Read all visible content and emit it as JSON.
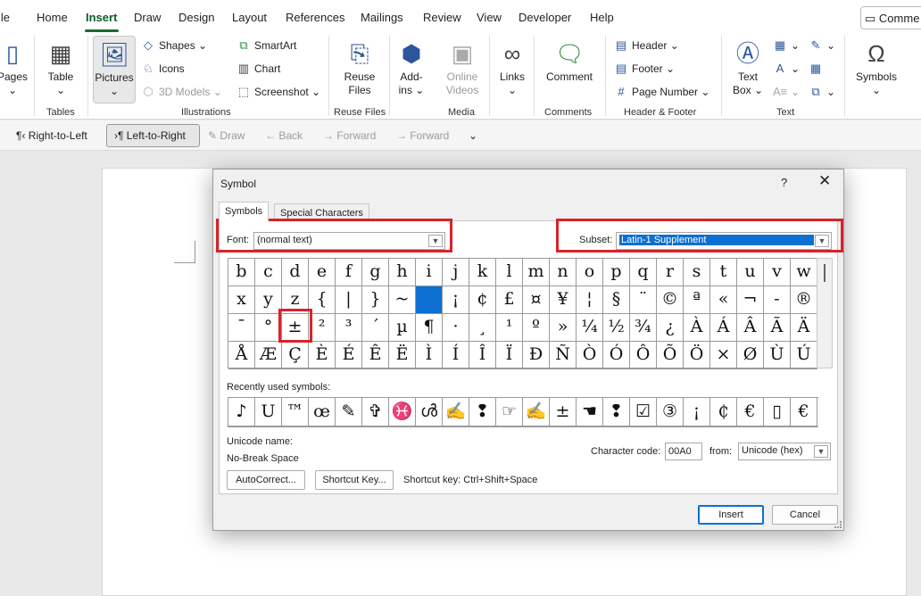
{
  "menubar": {
    "tabs": [
      "ile",
      "Home",
      "Insert",
      "Draw",
      "Design",
      "Layout",
      "References",
      "Mailings",
      "Review",
      "View",
      "Developer",
      "Help"
    ],
    "active_tab": "Insert",
    "comments_label": "Comme"
  },
  "ribbon": {
    "pages_label": "Pages",
    "table_label": "Table",
    "tables_group": "Tables",
    "pictures_label": "Pictures",
    "shapes_label": "Shapes",
    "icons_label": "Icons",
    "models3d_label": "3D Models",
    "smartart_label": "SmartArt",
    "chart_label": "Chart",
    "screenshot_label": "Screenshot",
    "illustrations_group": "Illustrations",
    "reuse_label_1": "Reuse",
    "reuse_label_2": "Files",
    "reuse_group": "Reuse Files",
    "addins_label_1": "Add-",
    "addins_label_2": "ins",
    "online_label_1": "Online",
    "online_label_2": "Videos",
    "media_group": "Media",
    "links_label": "Links",
    "comment_label": "Comment",
    "comments_group": "Comments",
    "header_label": "Header",
    "footer_label": "Footer",
    "pagenum_label": "Page Number",
    "hf_group": "Header & Footer",
    "textbox_label_1": "Text",
    "textbox_label_2": "Box",
    "text_group": "Text",
    "symbols_label": "Symbols"
  },
  "qat": {
    "rtl_label": "Right-to-Left",
    "ltr_label": "Left-to-Right",
    "draw_label": "Draw",
    "back_label": "Back",
    "forward1_label": "Forward",
    "forward2_label": "Forward"
  },
  "dialog": {
    "title": "Symbol",
    "help": "?",
    "close": "✕",
    "tab_symbols": "Symbols",
    "tab_special": "Special Characters",
    "font_label": "Font:",
    "font_value": "(normal text)",
    "subset_label": "Subset:",
    "subset_value": "Latin-1 Supplement",
    "grid_rows": [
      [
        "b",
        "c",
        "d",
        "e",
        "f",
        "g",
        "h",
        "i",
        "j",
        "k",
        "l",
        "m",
        "n",
        "o",
        "p",
        "q",
        "r",
        "s",
        "t",
        "u",
        "v",
        "w"
      ],
      [
        "x",
        "y",
        "z",
        "{",
        "|",
        "}",
        "~",
        "",
        "¡",
        "¢",
        "£",
        "¤",
        "¥",
        "¦",
        "§",
        "¨",
        "©",
        "ª",
        "«",
        "¬",
        "-",
        "®"
      ],
      [
        "¯",
        "°",
        "±",
        "²",
        "³",
        "´",
        "µ",
        "¶",
        "·",
        "¸",
        "¹",
        "º",
        "»",
        "¼",
        "½",
        "¾",
        "¿",
        "À",
        "Á",
        "Â",
        "Ã",
        "Ä"
      ],
      [
        "Å",
        "Æ",
        "Ç",
        "È",
        "É",
        "Ê",
        "Ë",
        "Ì",
        "Í",
        "Î",
        "Ï",
        "Ð",
        "Ñ",
        "Ò",
        "Ó",
        "Ô",
        "Õ",
        "Ö",
        "×",
        "Ø",
        "Ù",
        "Ú"
      ]
    ],
    "recent_label": "Recently used symbols:",
    "recent_symbols": [
      "♪",
      "U",
      "™",
      "œ",
      "✎",
      "✞",
      "♓",
      "ൾ",
      "✍",
      "❢",
      "☞",
      "✍",
      "±",
      "☚",
      "❢",
      "☑",
      "③",
      "¡",
      "₵",
      "€",
      "▯",
      "€"
    ],
    "unicode_name_label": "Unicode name:",
    "unicode_name_value": "No-Break Space",
    "charcode_label": "Character code:",
    "charcode_value": "00A0",
    "from_label": "from:",
    "from_value": "Unicode (hex)",
    "autocorrect_label": "AutoCorrect...",
    "shortcutkey_label": "Shortcut Key...",
    "shortcut_text": "Shortcut key: Ctrl+Shift+Space",
    "insert_label": "Insert",
    "cancel_label": "Cancel"
  },
  "colors": {
    "accent": "#0d6fd1",
    "highlight_box": "#d8232a",
    "tab_accent": "#1a6b32"
  }
}
